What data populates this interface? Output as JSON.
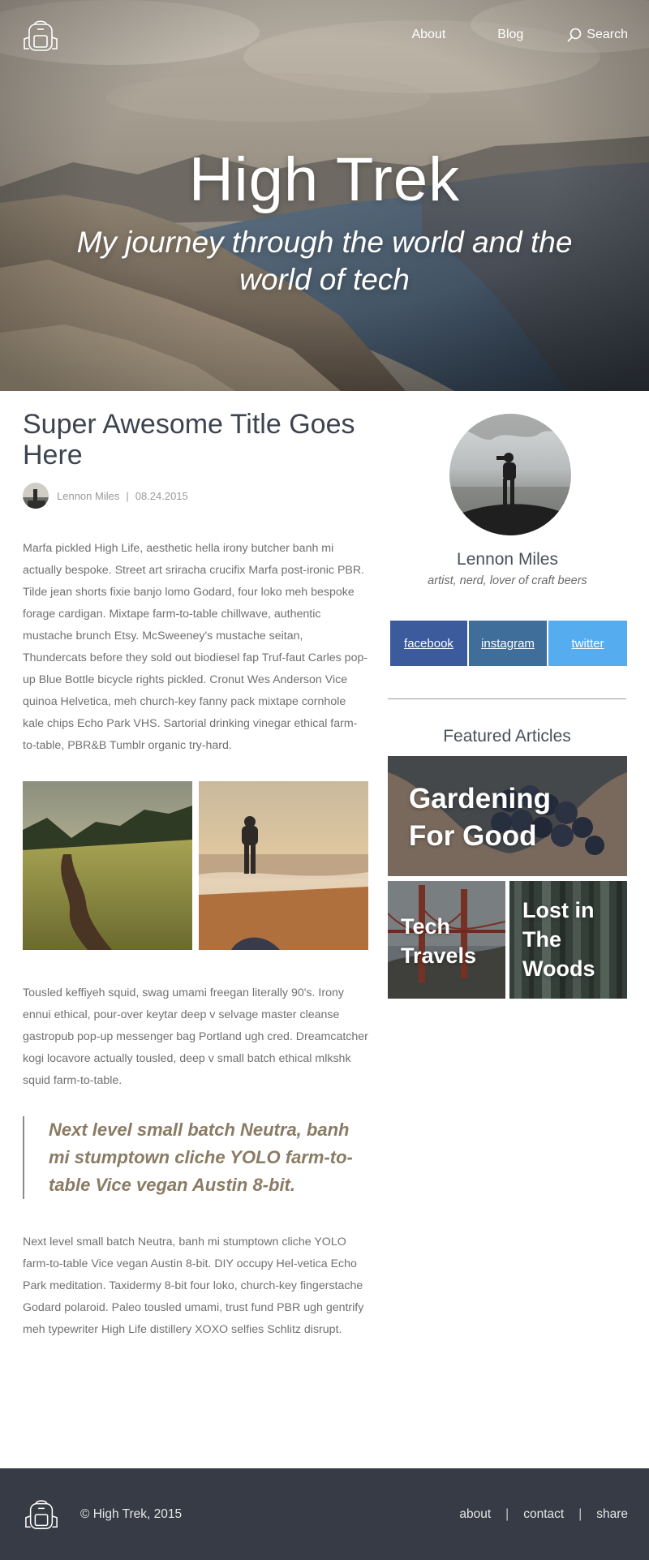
{
  "site": {
    "nav": {
      "about": "About",
      "blog": "Blog",
      "search": "Search"
    },
    "hero": {
      "title": "High Trek",
      "subtitle": "My journey through the world and the world of tech"
    }
  },
  "article": {
    "title": "Super Awesome Title Goes Here",
    "author": "Lennon Miles",
    "separator": "|",
    "date": "08.24.2015",
    "paragraph_1": "Marfa pickled High Life, aesthetic hella irony butcher banh mi actually bespoke. Street art sriracha crucifix Marfa post-ironic PBR. Tilde jean shorts fixie banjo lomo Godard, four loko meh bespoke forage cardigan. Mixtape farm-to-table chillwave, authentic mustache brunch Etsy. McSweeney's mustache seitan, Thundercats before they sold out biodiesel fap Truf-faut Carles pop-up Blue Bottle bicycle rights pickled. Cronut Wes Anderson Vice quinoa Helvetica, meh church-key fanny pack mixtape cornhole kale chips Echo Park VHS. Sartorial drinking vinegar ethical farm-to-table, PBR&B Tumblr organic try-hard.",
    "paragraph_2": "Tousled keffiyeh squid, swag umami freegan literally 90's. Irony ennui ethical, pour-over keytar deep v selvage master cleanse gastropub pop-up messenger bag Portland ugh cred. Dreamcatcher kogi locavore actually tousled, deep v small batch ethical mlkshk squid farm-to-table.",
    "quote": "Next level small batch Neutra, banh mi stumptown cliche YOLO farm-to-table Vice vegan Austin 8-bit.",
    "paragraph_3": "Next level small batch Neutra, banh mi stumptown cliche YOLO farm-to-table Vice vegan Austin 8-bit. DIY occupy Hel-vetica Echo Park meditation. Taxidermy 8-bit four loko, church-key fingerstache Godard polaroid. Paleo tousled umami, trust fund PBR ugh gentrify meh typewriter High Life distillery XOXO selfies Schlitz disrupt."
  },
  "sidebar": {
    "profile": {
      "name": "Lennon Miles",
      "bio": "artist, nerd, lover of craft beers"
    },
    "social": {
      "facebook": "facebook",
      "instagram": "instagram",
      "twitter": "twitter"
    },
    "featured_heading": "Featured Articles",
    "featured": [
      {
        "title": "Gardening For Good"
      },
      {
        "title": "Tech Travels"
      },
      {
        "title": "Lost in The Woods"
      }
    ]
  },
  "footer": {
    "copyright": "© High Trek, 2015",
    "links": {
      "about": "about",
      "contact": "contact",
      "share": "share",
      "separator": "|"
    }
  },
  "colors": {
    "facebook": "#3b5b9c",
    "instagram": "#3e6e99",
    "twitter": "#55acee",
    "footer_bg": "#363b45",
    "quote_text": "#8a7b63",
    "heading_text": "#3d4450"
  }
}
